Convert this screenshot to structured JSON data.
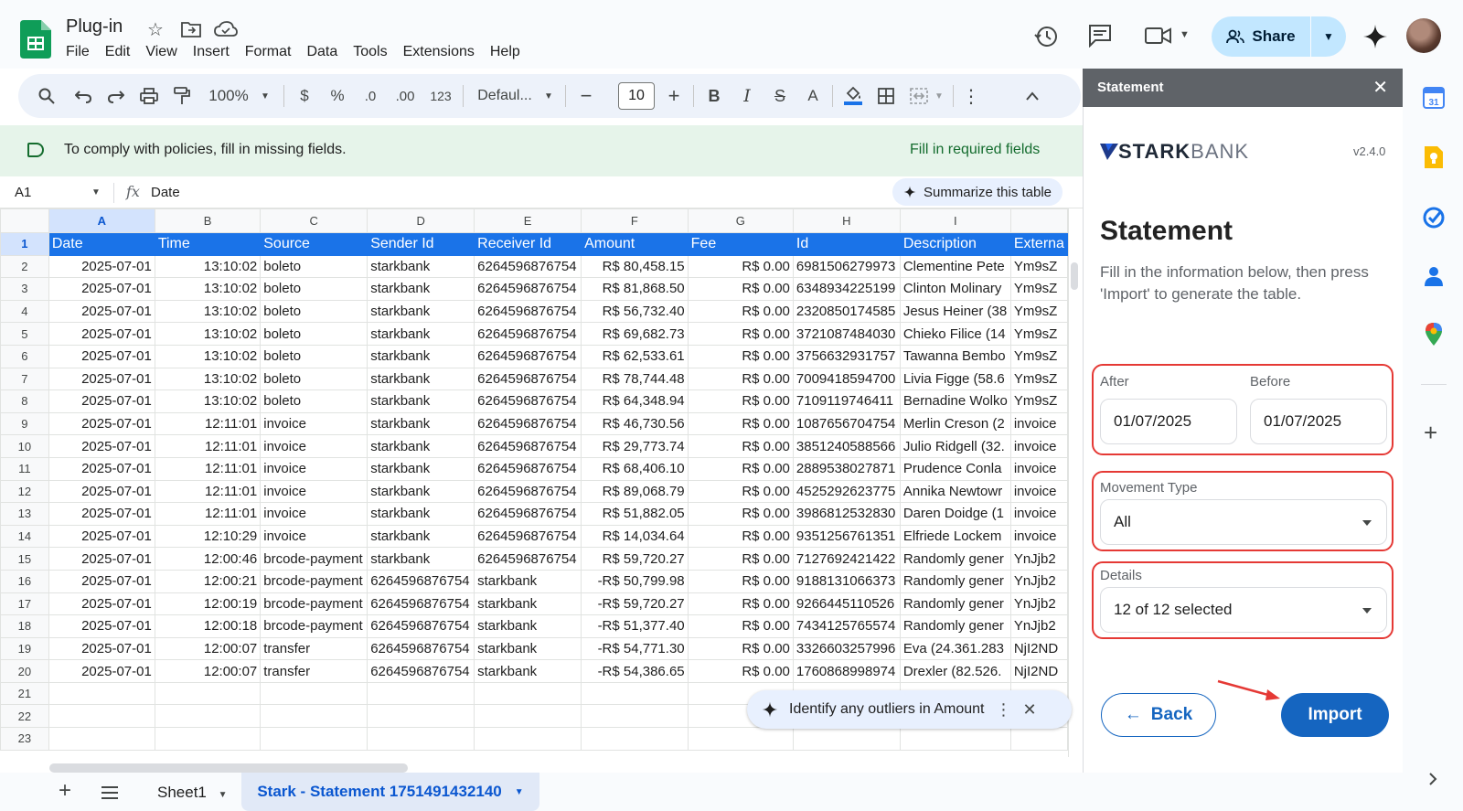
{
  "app": {
    "doc_title": "Plug-in",
    "menu": [
      "File",
      "Edit",
      "View",
      "Insert",
      "Format",
      "Data",
      "Tools",
      "Extensions",
      "Help"
    ],
    "share_label": "Share"
  },
  "toolbar": {
    "zoom": "100%",
    "currency": "$",
    "percent": "%",
    "dec_decrease": ".0",
    "dec_increase": ".00",
    "number_format": "123",
    "font": "Defaul...",
    "font_size": "10"
  },
  "banner": {
    "text": "To comply with policies, fill in missing fields.",
    "action": "Fill in required fields"
  },
  "formula_bar": {
    "cell_ref": "A1",
    "fx": "fx",
    "value": "Date",
    "summarize_label": "Summarize this table"
  },
  "grid": {
    "columns": [
      "A",
      "B",
      "C",
      "D",
      "E",
      "F",
      "G",
      "H",
      "I"
    ],
    "headers": [
      "Date",
      "Time",
      "Source",
      "Sender Id",
      "Receiver Id",
      "Amount",
      "Fee",
      "Id",
      "Description",
      "Externa"
    ],
    "rows": [
      [
        "2025-07-01",
        "13:10:02",
        "boleto",
        "starkbank",
        "6264596876754",
        "R$ 80,458.15",
        "R$ 0.00",
        "6981506279973",
        "Clementine Pete",
        "Ym9sZ"
      ],
      [
        "2025-07-01",
        "13:10:02",
        "boleto",
        "starkbank",
        "6264596876754",
        "R$ 81,868.50",
        "R$ 0.00",
        "6348934225199",
        "Clinton Molinary",
        "Ym9sZ"
      ],
      [
        "2025-07-01",
        "13:10:02",
        "boleto",
        "starkbank",
        "6264596876754",
        "R$ 56,732.40",
        "R$ 0.00",
        "2320850174585",
        "Jesus Heiner (38",
        "Ym9sZ"
      ],
      [
        "2025-07-01",
        "13:10:02",
        "boleto",
        "starkbank",
        "6264596876754",
        "R$ 69,682.73",
        "R$ 0.00",
        "3721087484030",
        "Chieko Filice (14",
        "Ym9sZ"
      ],
      [
        "2025-07-01",
        "13:10:02",
        "boleto",
        "starkbank",
        "6264596876754",
        "R$ 62,533.61",
        "R$ 0.00",
        "3756632931757",
        "Tawanna Bembo",
        "Ym9sZ"
      ],
      [
        "2025-07-01",
        "13:10:02",
        "boleto",
        "starkbank",
        "6264596876754",
        "R$ 78,744.48",
        "R$ 0.00",
        "7009418594700",
        "Livia Figge (58.6",
        "Ym9sZ"
      ],
      [
        "2025-07-01",
        "13:10:02",
        "boleto",
        "starkbank",
        "6264596876754",
        "R$ 64,348.94",
        "R$ 0.00",
        "7109119746411",
        "Bernadine Wolko",
        "Ym9sZ"
      ],
      [
        "2025-07-01",
        "12:11:01",
        "invoice",
        "starkbank",
        "6264596876754",
        "R$ 46,730.56",
        "R$ 0.00",
        "1087656704754",
        "Merlin Creson (2",
        "invoice"
      ],
      [
        "2025-07-01",
        "12:11:01",
        "invoice",
        "starkbank",
        "6264596876754",
        "R$ 29,773.74",
        "R$ 0.00",
        "3851240588566",
        "Julio Ridgell (32.",
        "invoice"
      ],
      [
        "2025-07-01",
        "12:11:01",
        "invoice",
        "starkbank",
        "6264596876754",
        "R$ 68,406.10",
        "R$ 0.00",
        "2889538027871",
        "Prudence Conla",
        "invoice"
      ],
      [
        "2025-07-01",
        "12:11:01",
        "invoice",
        "starkbank",
        "6264596876754",
        "R$ 89,068.79",
        "R$ 0.00",
        "4525292623775",
        "Annika Newtowr",
        "invoice"
      ],
      [
        "2025-07-01",
        "12:11:01",
        "invoice",
        "starkbank",
        "6264596876754",
        "R$ 51,882.05",
        "R$ 0.00",
        "3986812532830",
        "Daren Doidge (1",
        "invoice"
      ],
      [
        "2025-07-01",
        "12:10:29",
        "invoice",
        "starkbank",
        "6264596876754",
        "R$ 14,034.64",
        "R$ 0.00",
        "9351256761351",
        "Elfriede Lockem",
        "invoice"
      ],
      [
        "2025-07-01",
        "12:00:46",
        "brcode-payment",
        "starkbank",
        "6264596876754",
        "R$ 59,720.27",
        "R$ 0.00",
        "7127692421422",
        "Randomly gener",
        "YnJjb2"
      ],
      [
        "2025-07-01",
        "12:00:21",
        "brcode-payment",
        "6264596876754",
        "starkbank",
        "-R$ 50,799.98",
        "R$ 0.00",
        "9188131066373",
        "Randomly gener",
        "YnJjb2"
      ],
      [
        "2025-07-01",
        "12:00:19",
        "brcode-payment",
        "6264596876754",
        "starkbank",
        "-R$ 59,720.27",
        "R$ 0.00",
        "9266445110526",
        "Randomly gener",
        "YnJjb2"
      ],
      [
        "2025-07-01",
        "12:00:18",
        "brcode-payment",
        "6264596876754",
        "starkbank",
        "-R$ 51,377.40",
        "R$ 0.00",
        "7434125765574",
        "Randomly gener",
        "YnJjb2"
      ],
      [
        "2025-07-01",
        "12:00:07",
        "transfer",
        "6264596876754",
        "starkbank",
        "-R$ 54,771.30",
        "R$ 0.00",
        "3326603257996",
        "Eva (24.361.283",
        "NjI2ND"
      ],
      [
        "2025-07-01",
        "12:00:07",
        "transfer",
        "6264596876754",
        "starkbank",
        "-R$ 54,386.65",
        "R$ 0.00",
        "1760868998974",
        "Drexler (82.526.",
        "NjI2ND"
      ]
    ],
    "row_numbers": [
      "1",
      "2",
      "3",
      "4",
      "5",
      "6",
      "7",
      "8",
      "9",
      "10",
      "11",
      "12",
      "13",
      "14",
      "15",
      "16",
      "17",
      "18",
      "19",
      "20",
      "21",
      "22",
      "23"
    ]
  },
  "outliers_chip": {
    "label": "Identify any outliers in Amount"
  },
  "sheet_tabs": {
    "sheet1": "Sheet1",
    "active": "Stark - Statement 1751491432140"
  },
  "panel": {
    "header": "Statement",
    "brand_bold": "STARK",
    "brand_light": "BANK",
    "version": "v2.4.0",
    "title": "Statement",
    "description": "Fill in the information below, then press 'Import' to generate the table.",
    "after_label": "After",
    "after_value": "01/07/2025",
    "before_label": "Before",
    "before_value": "01/07/2025",
    "movement_label": "Movement Type",
    "movement_value": "All",
    "details_label": "Details",
    "details_value": "12 of 12 selected",
    "back_label": "Back",
    "import_label": "Import"
  },
  "colors": {
    "accent": "#1565c0",
    "highlight_red": "#e53935",
    "sheet_header_blue": "#1a73e8"
  }
}
